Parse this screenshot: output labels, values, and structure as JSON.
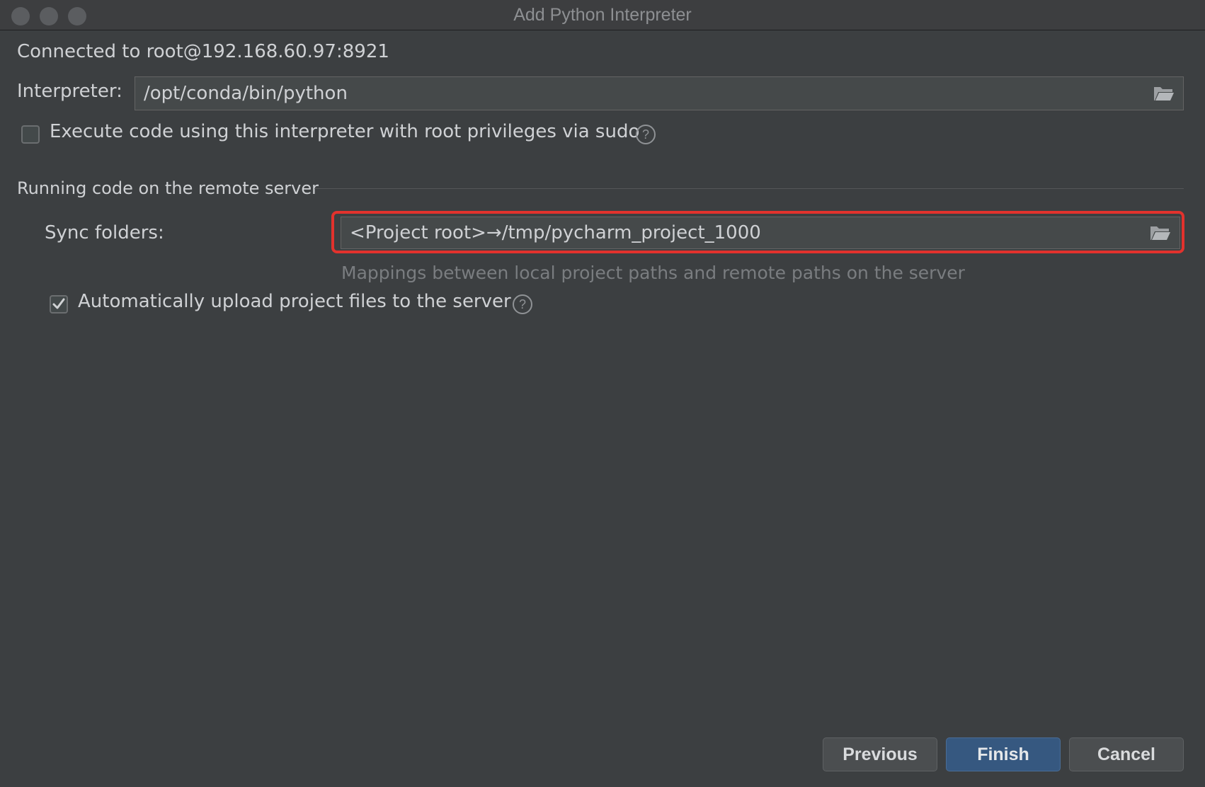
{
  "window": {
    "title": "Add Python Interpreter"
  },
  "connection": {
    "status_text": "Connected to root@192.168.60.97:8921"
  },
  "interpreter": {
    "label": "Interpreter:",
    "value": "/opt/conda/bin/python",
    "browse_icon": "folder-open-icon"
  },
  "sudo_option": {
    "label": "Execute code using this interpreter with root privileges via sudo",
    "checked": false,
    "help_icon": "help-icon"
  },
  "remote_section": {
    "title": "Running code on the remote server",
    "sync_label": "Sync folders:",
    "sync_value": "<Project root>→/tmp/pycharm_project_1000",
    "sync_hint": "Mappings between local project paths and remote paths on the server",
    "auto_upload_label": "Automatically upload project files to the server",
    "auto_upload_checked": true
  },
  "buttons": {
    "previous": "Previous",
    "finish": "Finish",
    "cancel": "Cancel"
  },
  "colors": {
    "background": "#3c3f41",
    "field_background": "#45494a",
    "highlight_border": "#e2322d",
    "primary_button": "#365880"
  }
}
